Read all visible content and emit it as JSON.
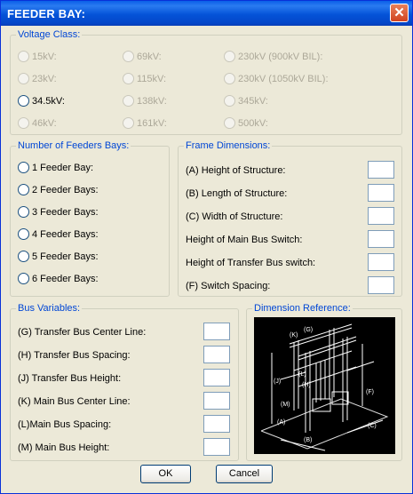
{
  "window": {
    "title": "FEEDER BAY:",
    "close_label": "✕"
  },
  "voltage_class": {
    "label": "Voltage Class:",
    "options": [
      "15kV:",
      "69kV:",
      "230kV (900kV BIL):",
      "23kV:",
      "115kV:",
      "230kV (1050kV BIL):",
      "34.5kV:",
      "138kV:",
      "345kV:",
      "46kV:",
      "161kV:",
      "500kV:"
    ]
  },
  "feeder_bays": {
    "label": "Number of Feeders Bays:",
    "options": [
      "1 Feeder Bay:",
      "2 Feeder Bays:",
      "3 Feeder Bays:",
      "4 Feeder Bays:",
      "5 Feeder Bays:",
      "6 Feeder Bays:"
    ]
  },
  "frame_dimensions": {
    "label": "Frame Dimensions:",
    "fields": [
      "(A) Height of Structure:",
      "(B) Length of Structure:",
      "(C) Width of Structure:",
      "Height of Main Bus Switch:",
      "Height of Transfer Bus switch:",
      "(F) Switch Spacing:"
    ]
  },
  "bus_variables": {
    "label": "Bus Variables:",
    "fields": [
      "(G) Transfer Bus Center Line:",
      "(H) Transfer Bus Spacing:",
      "(J) Transfer Bus Height:",
      "(K) Main Bus Center Line:",
      "(L)Main Bus Spacing:",
      "(M) Main Bus Height:"
    ]
  },
  "dimension_reference": {
    "label": "Dimension Reference:",
    "tags": [
      "(K)",
      "(G)",
      "(J)",
      "(L)",
      "(H)",
      "(M)",
      "(F)",
      "(B)",
      "(C)",
      "(A)"
    ]
  },
  "buttons": {
    "ok": "OK",
    "cancel": "Cancel"
  }
}
